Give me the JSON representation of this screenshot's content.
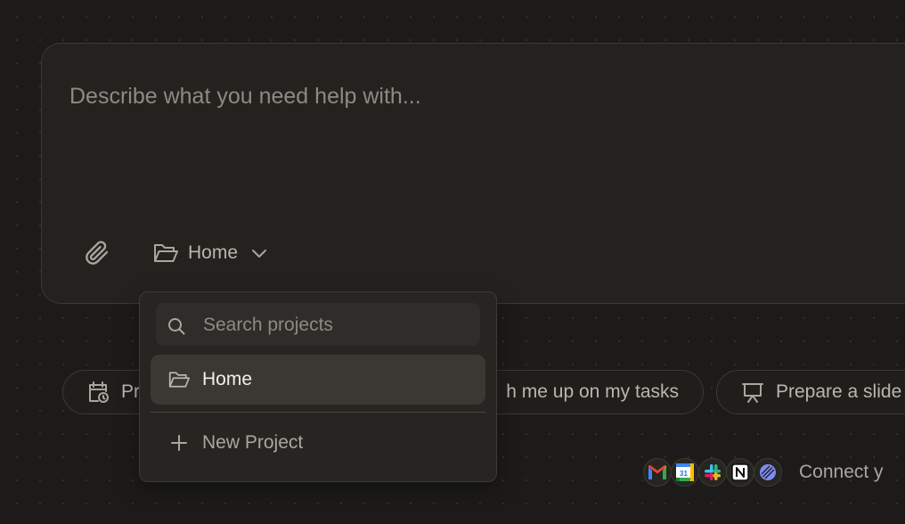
{
  "composer": {
    "placeholder": "Describe what you need help with...",
    "attach_icon": "paperclip-icon",
    "project_selector": {
      "label": "Home",
      "icon": "folder-open-icon",
      "chevron": "chevron-down-icon"
    }
  },
  "project_dropdown": {
    "search_placeholder": "Search projects",
    "search_icon": "search-icon",
    "items": [
      {
        "label": "Home",
        "icon": "folder-open-icon",
        "selected": true
      }
    ],
    "new_project_label": "New Project",
    "new_project_icon": "plus-icon"
  },
  "suggestions": [
    {
      "label": "Pr",
      "icon": "calendar-clock-icon"
    },
    {
      "label": "h me up on my tasks",
      "icon": ""
    },
    {
      "label": "Prepare a slide",
      "icon": "presentation-icon"
    }
  ],
  "integrations": {
    "apps": [
      "gmail-icon",
      "google-calendar-icon",
      "slack-icon",
      "notion-icon",
      "linear-icon"
    ],
    "calendar_day": "31",
    "connect_label": "Connect y"
  },
  "colors": {
    "background": "#1c1b19",
    "panel": "#23221f",
    "selected_item": "#3a3832",
    "muted_text": "#8d8a82"
  }
}
